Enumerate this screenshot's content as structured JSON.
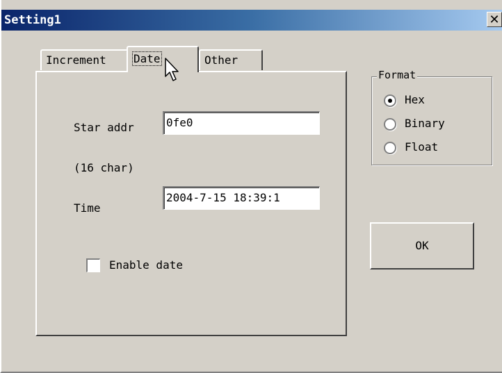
{
  "window": {
    "title": "Setting1",
    "close_glyph": "✕"
  },
  "tabs": [
    {
      "label": "Increment",
      "active": false
    },
    {
      "label": "Date",
      "active": true
    },
    {
      "label": "Other",
      "active": false
    }
  ],
  "date_panel": {
    "start_addr_label": "Star addr",
    "start_addr_value": "0fe0",
    "char_hint": "(16 char)",
    "time_label": "Time",
    "time_value": "2004-7-15 18:39:1",
    "enable_date_label": "Enable date",
    "enable_date_checked": false
  },
  "format_group": {
    "title": "Format",
    "options": [
      {
        "label": "Hex",
        "selected": true
      },
      {
        "label": "Binary",
        "selected": false
      },
      {
        "label": "Float",
        "selected": false
      }
    ]
  },
  "ok_button": {
    "label": "OK"
  },
  "colors": {
    "face": "#d4d0c8",
    "title_start": "#0a246a",
    "title_end": "#a6caf0"
  },
  "icons": {
    "cursor": "arrow-cursor-icon"
  }
}
